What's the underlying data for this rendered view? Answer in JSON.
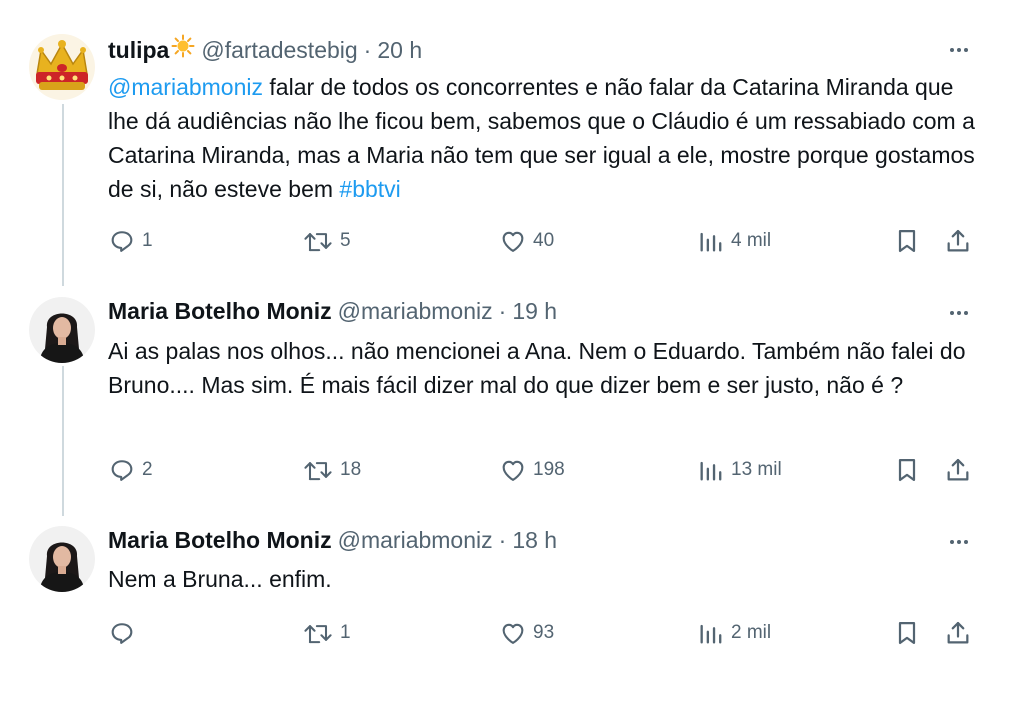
{
  "tweets": [
    {
      "name": "tulipa",
      "handle": "@fartadestebig",
      "time": "20 h",
      "mention": "@mariabmoniz",
      "text": " falar de todos os concorrentes e não falar da Catarina Miranda que lhe dá audiências não lhe ficou bem, sabemos que o Cláudio é um ressabiado com a Catarina Miranda, mas a Maria não tem que ser igual a ele, mostre porque gostamos de si, não esteve bem ",
      "hashtag": "#bbtvi",
      "replies": "1",
      "retweets": "5",
      "likes": "40",
      "views": "4 mil"
    },
    {
      "name": "Maria Botelho Moniz",
      "handle": "@mariabmoniz",
      "time": "19 h",
      "text": "Ai as palas nos olhos... não mencionei a Ana. Nem o Eduardo. Também não falei do Bruno.... Mas sim. É mais fácil dizer mal do que dizer bem e ser justo, não é ?",
      "replies": "2",
      "retweets": "18",
      "likes": "198",
      "views": "13 mil"
    },
    {
      "name": "Maria Botelho Moniz",
      "handle": "@mariabmoniz",
      "time": "18 h",
      "text": "Nem a Bruna... enfim.",
      "replies": "",
      "retweets": "1",
      "likes": "93",
      "views": "2 mil"
    }
  ],
  "separator": "·",
  "icons": {
    "reply": "reply-icon",
    "retweet": "retweet-icon",
    "like": "heart-icon",
    "views": "views-icon",
    "bookmark": "bookmark-icon",
    "share": "share-icon",
    "more": "more-icon",
    "emoji": "sun-emoji"
  },
  "colors": {
    "link": "#1d9bf0",
    "secondary": "#536471",
    "text": "#0f1419",
    "thread_line": "#cfd9de"
  }
}
